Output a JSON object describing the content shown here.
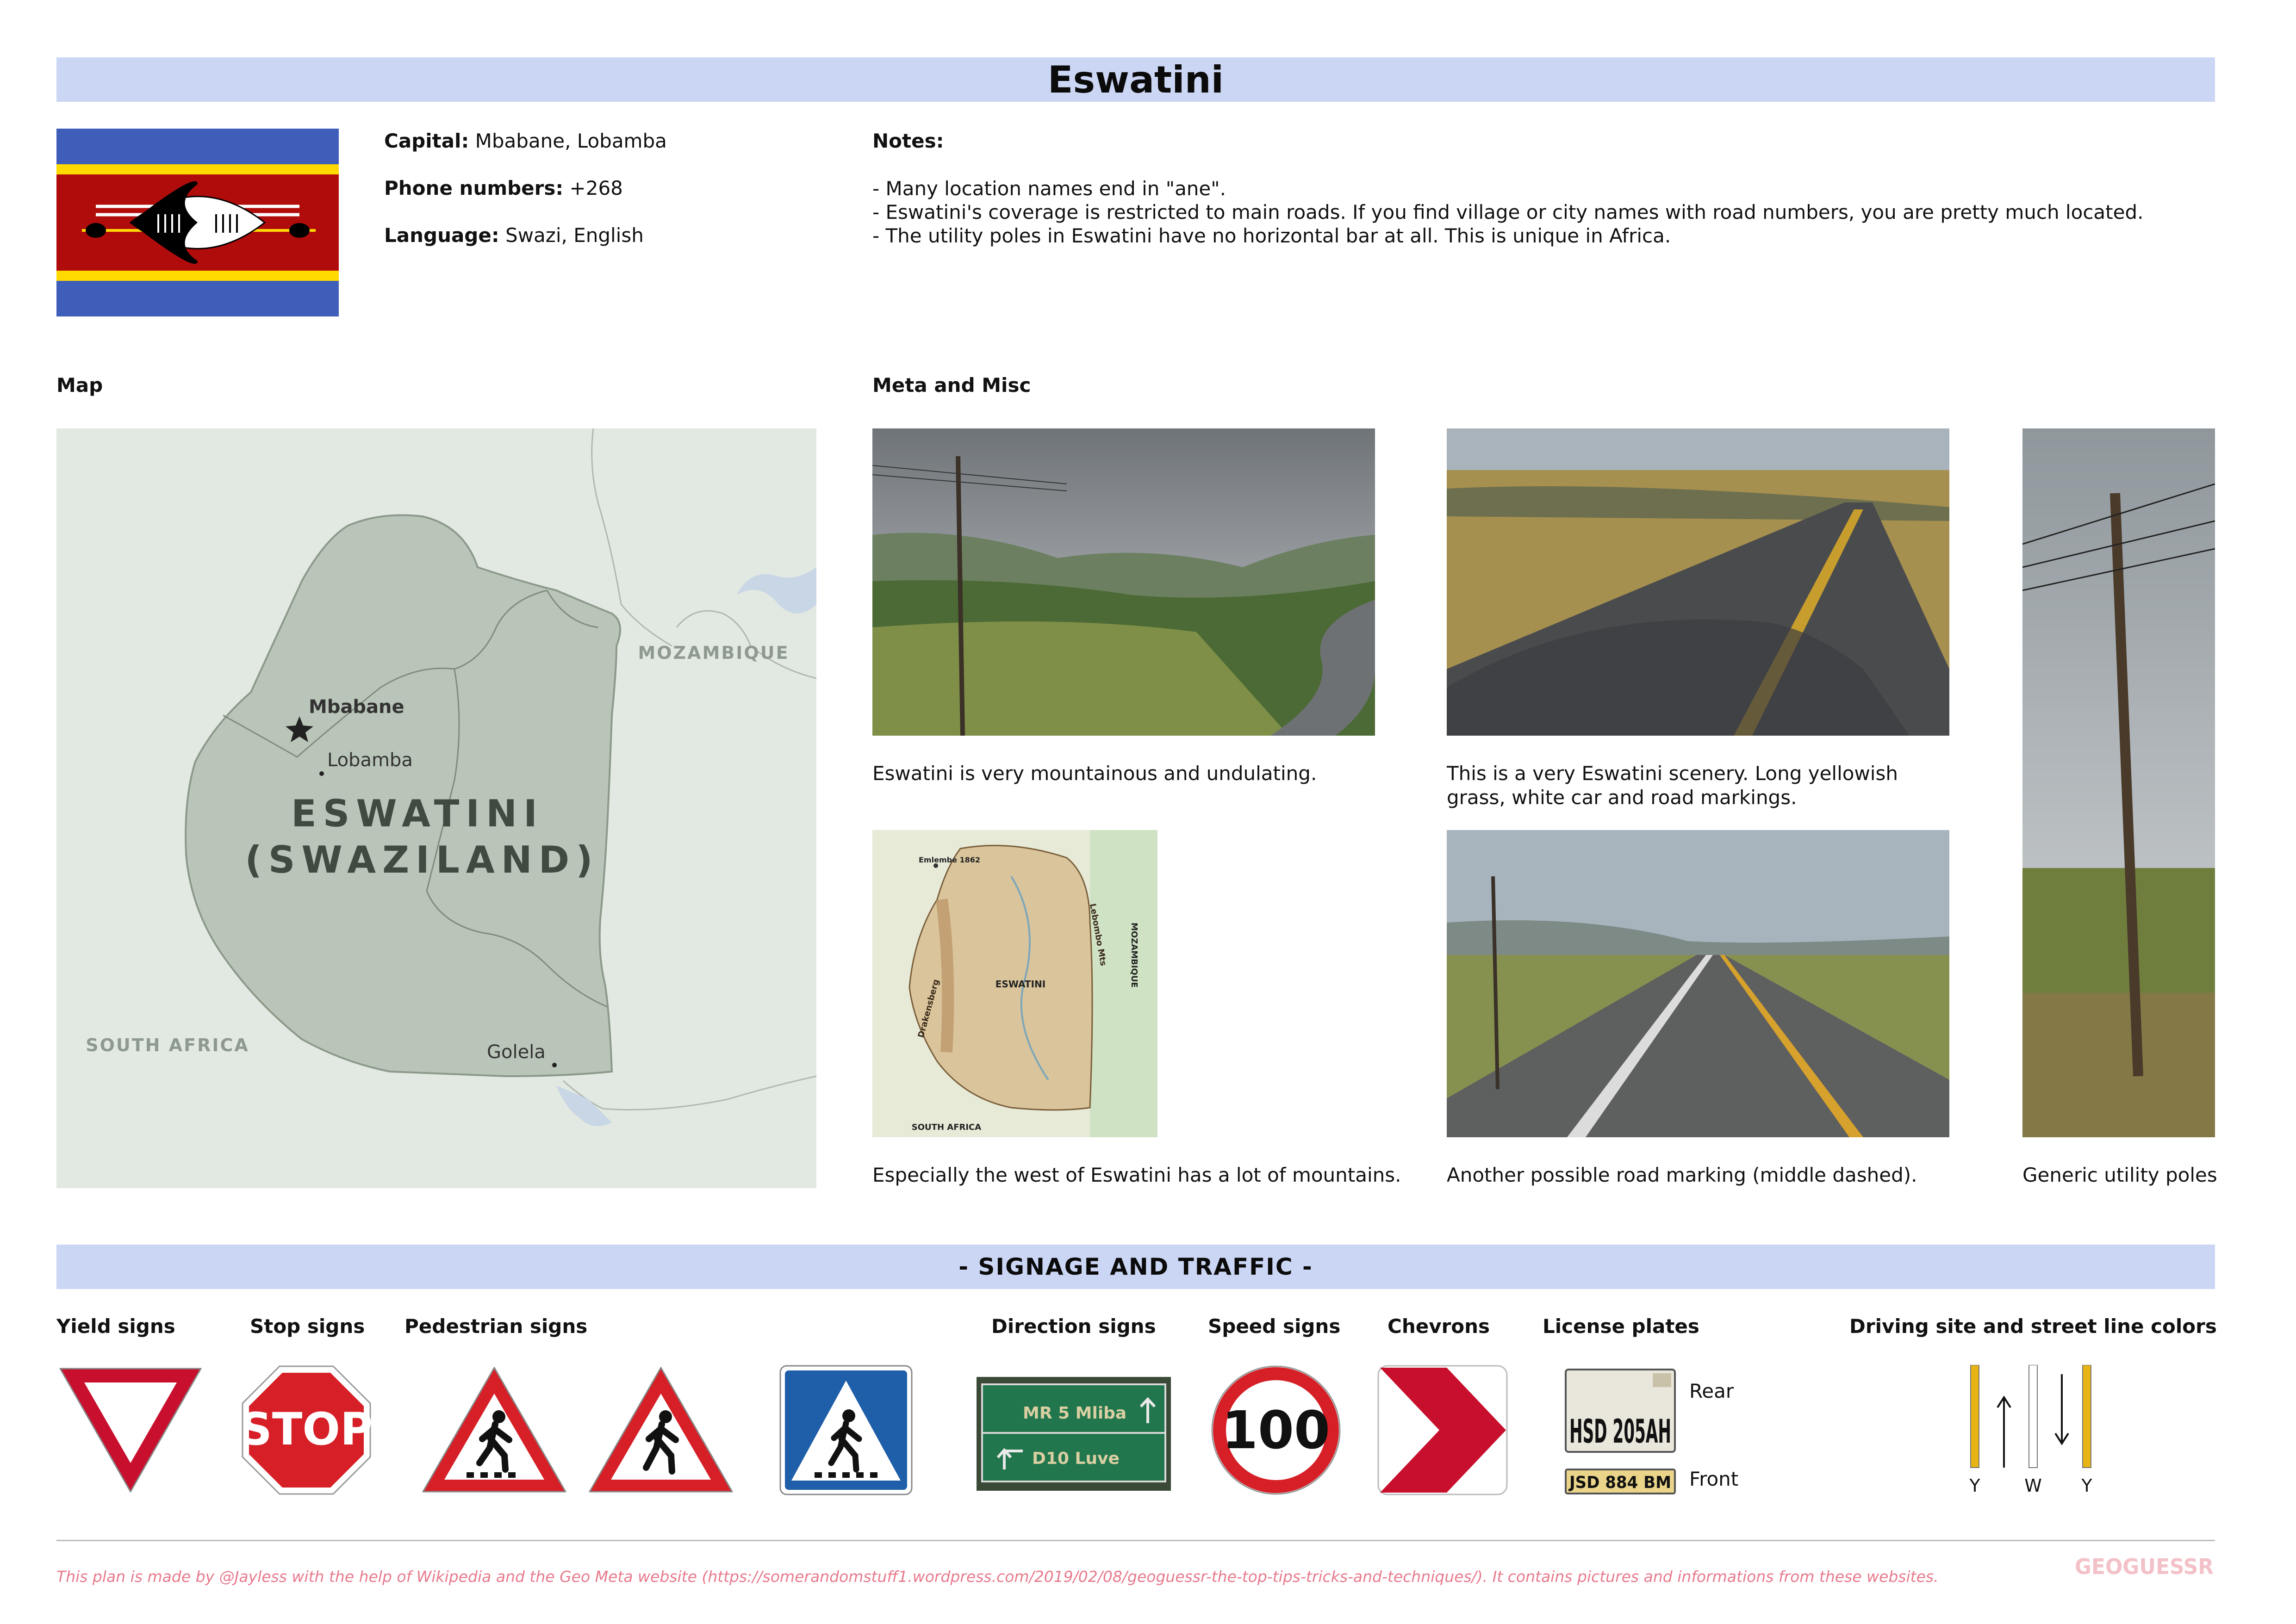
{
  "title": "Eswatini",
  "info": {
    "capital_label": "Capital:",
    "capital_value": "Mbabane, Lobamba",
    "phone_label": "Phone numbers:",
    "phone_value": "+268",
    "language_label": "Language:",
    "language_value": "Swazi, English"
  },
  "notes": {
    "label": "Notes:",
    "lines": [
      "- Many location names end in \"ane\".",
      "- Eswatini's coverage is restricted to main roads. If you find village or city names with road numbers, you are pretty much located.",
      "- The utility poles in Eswatini have no horizontal bar at all. This is unique in Africa."
    ]
  },
  "map": {
    "label": "Map",
    "country_line1": "ESWATINI",
    "country_line2": "(SWAZILAND)",
    "neighbor_east": "MOZAMBIQUE",
    "neighbor_west": "SOUTH AFRICA",
    "cities": [
      "Mbabane",
      "Lobamba",
      "Golela"
    ]
  },
  "meta": {
    "label": "Meta and Misc",
    "captions": [
      "Eswatini is very mountainous and undulating.",
      "This is a very Eswatini scenery. Long yellowish grass, white car and road markings.",
      "Especially the west of Eswatini has a lot of mountains.",
      "Another possible road marking (middle dashed).",
      "Generic utility poles"
    ],
    "relief_map_labels": {
      "country": "ESWATINI",
      "west": "SOUTH AFRICA",
      "east": "MOZAMBIQUE",
      "range_west": "Drakensberg",
      "range_east": "Lebombo Mts",
      "peak": "Emlembe 1862"
    }
  },
  "signage": {
    "title": "- SIGNAGE AND TRAFFIC -",
    "labels": {
      "yield": "Yield signs",
      "stop": "Stop signs",
      "pedestrian": "Pedestrian signs",
      "direction": "Direction signs",
      "speed": "Speed signs",
      "chevrons": "Chevrons",
      "plates": "License plates",
      "driving": "Driving site and street line colors"
    },
    "stop_text": "STOP",
    "speed_text": "100",
    "direction_lines": [
      "MR 5 Mliba",
      "D10 Luve"
    ],
    "plate_rear": "HSD 205AH",
    "plate_front": "JSD 884 BM",
    "plate_rear_label": "Rear",
    "plate_front_label": "Front",
    "line_labels": [
      "Y",
      "W",
      "Y"
    ]
  },
  "footer": {
    "text": "This plan is made by @Jayless with the help of Wikipedia and the Geo Meta website (https://somerandomstuff1.wordpress.com/2019/02/08/geoguessr-the-top-tips-tricks-and-techniques/). It contains pictures and informations from these websites.",
    "logo": "GEOGUESSR"
  },
  "colors": {
    "banner": "#cbd6f4",
    "flag_blue": "#3e5eb9",
    "flag_yellow": "#ffd900",
    "flag_red": "#b10c0c",
    "map_land": "#b9c5b8",
    "map_bg": "#e2e9e2",
    "sign_red": "#c8102e",
    "line_yellow": "#e7b416",
    "footer": "#e77a8c"
  }
}
